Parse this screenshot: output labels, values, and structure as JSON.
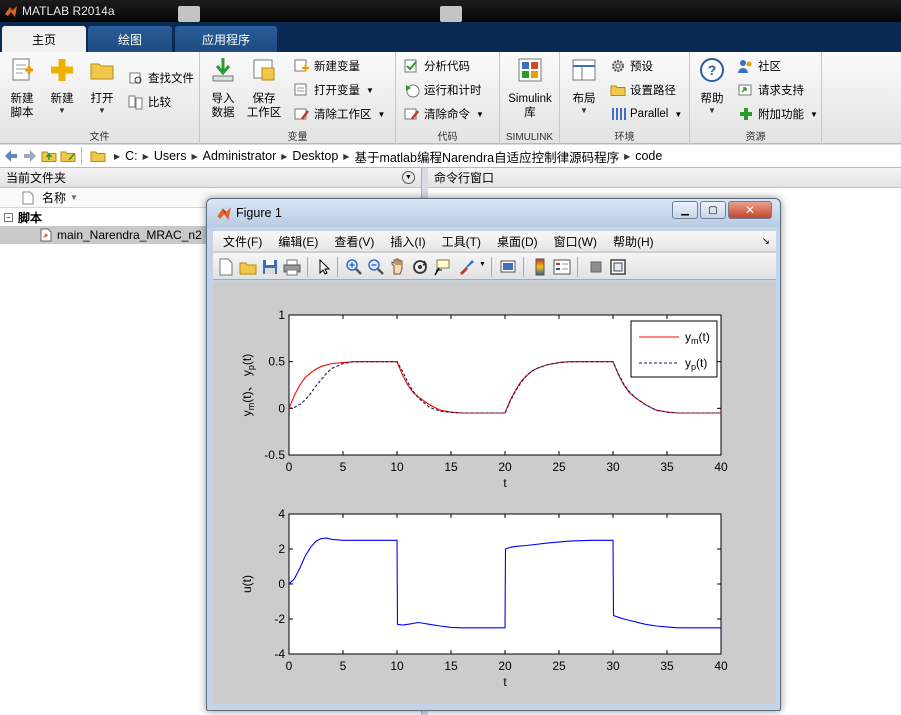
{
  "window": {
    "title": "MATLAB R2014a"
  },
  "tabs": [
    {
      "label": "主页",
      "active": true
    },
    {
      "label": "绘图",
      "active": false
    },
    {
      "label": "应用程序",
      "active": false
    }
  ],
  "toolstrip": {
    "file": {
      "label": "文件",
      "new_script_l1": "新建",
      "new_script_l2": "脚本",
      "new_label": "新建",
      "open_label": "打开",
      "find_files": "查找文件",
      "compare": "比较"
    },
    "variable": {
      "label": "变量",
      "import_l1": "导入",
      "import_l2": "数据",
      "save_l1": "保存",
      "save_l2": "工作区",
      "new_variable": "新建变量",
      "open_variable": "打开变量",
      "clear_workspace": "清除工作区"
    },
    "code": {
      "label": "代码",
      "analyze": "分析代码",
      "run_time": "运行和计时",
      "clear_commands": "清除命令"
    },
    "simulink": {
      "label": "SIMULINK",
      "lib_l1": "Simulink",
      "lib_l2": "库"
    },
    "environment": {
      "label": "环境",
      "layout": "布局",
      "preferences": "预设",
      "set_path": "设置路径",
      "parallel": "Parallel"
    },
    "resources": {
      "label": "资源",
      "help": "帮助",
      "community": "社区",
      "request_support": "请求支持",
      "add_ons": "附加功能"
    }
  },
  "address": {
    "crumbs": [
      "C:",
      "Users",
      "Administrator",
      "Desktop",
      "基于matlab编程Narendra自适应控制律源码程序",
      "code"
    ]
  },
  "current_folder": {
    "title": "当前文件夹",
    "column_name": "名称",
    "group": "脚本",
    "file": "main_Narendra_MRAC_n2"
  },
  "command_window": {
    "title": "命令行窗口"
  },
  "figure": {
    "title": "Figure 1",
    "menu": [
      "文件(F)",
      "编辑(E)",
      "查看(V)",
      "插入(I)",
      "工具(T)",
      "桌面(D)",
      "窗口(W)",
      "帮助(H)"
    ]
  },
  "colors": {
    "ym": "#ff0000",
    "yp": "#1a1a60",
    "u": "#0000ff"
  },
  "chart_data": [
    {
      "type": "line",
      "xlabel": "t",
      "ylabel": "y_m(t)、 y_p(t)",
      "xlim": [
        0,
        40
      ],
      "ylim": [
        -0.5,
        1
      ],
      "xticks": [
        0,
        5,
        10,
        15,
        20,
        25,
        30,
        35,
        40
      ],
      "yticks": [
        -0.5,
        0,
        0.5,
        1
      ],
      "legend_position": "top-right",
      "series": [
        {
          "name": "y_m(t)",
          "style": "solid",
          "x": [
            0,
            0.5,
            1,
            1.5,
            2,
            2.5,
            3,
            4,
            5,
            6,
            8,
            10,
            10.5,
            11,
            11.5,
            12,
            12.5,
            13,
            14,
            15,
            16,
            18,
            20,
            20.5,
            21,
            21.5,
            22,
            22.5,
            23,
            24,
            25,
            26,
            28,
            30,
            30.5,
            31,
            31.5,
            32,
            32.5,
            33,
            34,
            35,
            36,
            38,
            40
          ],
          "y": [
            0,
            0.14,
            0.25,
            0.33,
            0.38,
            0.42,
            0.45,
            0.48,
            0.49,
            0.5,
            0.5,
            0.5,
            0.36,
            0.25,
            0.17,
            0.12,
            0.08,
            0.04,
            -0.02,
            -0.04,
            -0.05,
            -0.05,
            -0.05,
            0.09,
            0.2,
            0.29,
            0.35,
            0.4,
            0.43,
            0.47,
            0.49,
            0.5,
            0.5,
            0.5,
            0.36,
            0.25,
            0.17,
            0.12,
            0.08,
            0.04,
            -0.02,
            -0.04,
            -0.05,
            -0.05,
            -0.05
          ]
        },
        {
          "name": "y_p(t)",
          "style": "dashed",
          "x": [
            0,
            0.5,
            1,
            1.5,
            2,
            2.5,
            3,
            3.5,
            4,
            5,
            6,
            8,
            10,
            10.5,
            11,
            11.5,
            12,
            12.5,
            13,
            14,
            15,
            16,
            18,
            20,
            20.5,
            21,
            21.5,
            22,
            22.5,
            23,
            24,
            25,
            26,
            28,
            30,
            30.5,
            31,
            31.5,
            32,
            32.5,
            33,
            34,
            35,
            36,
            38,
            40
          ],
          "y": [
            0,
            0.01,
            0.04,
            0.09,
            0.16,
            0.24,
            0.31,
            0.38,
            0.43,
            0.48,
            0.5,
            0.5,
            0.5,
            0.4,
            0.28,
            0.18,
            0.11,
            0.06,
            0.01,
            -0.03,
            -0.045,
            -0.05,
            -0.05,
            -0.05,
            0.08,
            0.19,
            0.28,
            0.35,
            0.4,
            0.43,
            0.47,
            0.49,
            0.5,
            0.5,
            0.5,
            0.37,
            0.26,
            0.18,
            0.12,
            0.08,
            0.04,
            -0.02,
            -0.04,
            -0.05,
            -0.05,
            -0.05
          ]
        }
      ]
    },
    {
      "type": "line",
      "xlabel": "t",
      "ylabel": "u(t)",
      "xlim": [
        0,
        40
      ],
      "ylim": [
        -4,
        4
      ],
      "xticks": [
        0,
        5,
        10,
        15,
        20,
        25,
        30,
        35,
        40
      ],
      "yticks": [
        -4,
        -2,
        0,
        2,
        4
      ],
      "series": [
        {
          "style": "solid",
          "x": [
            0,
            0.5,
            1,
            1.5,
            2,
            2.5,
            3,
            3.5,
            4,
            5,
            6,
            8,
            10,
            10.05,
            10.5,
            11,
            12,
            13,
            14,
            15,
            16,
            18,
            20,
            20.05,
            20.5,
            21,
            22,
            24,
            26,
            28,
            30,
            30.05,
            30.5,
            31,
            32,
            33,
            34,
            35,
            36,
            38,
            40
          ],
          "y": [
            0,
            0.3,
            0.9,
            1.6,
            2.1,
            2.45,
            2.6,
            2.62,
            2.55,
            2.5,
            2.5,
            2.5,
            2.5,
            -2.3,
            -2.35,
            -2.3,
            -2.2,
            -2.3,
            -2.4,
            -2.48,
            -2.5,
            -2.5,
            -2.5,
            2.0,
            2.1,
            2.15,
            2.2,
            2.35,
            2.45,
            2.5,
            2.5,
            -1.8,
            -1.9,
            -2.0,
            -2.15,
            -2.3,
            -2.4,
            -2.45,
            -2.5,
            -2.5,
            -2.5
          ]
        }
      ]
    }
  ]
}
